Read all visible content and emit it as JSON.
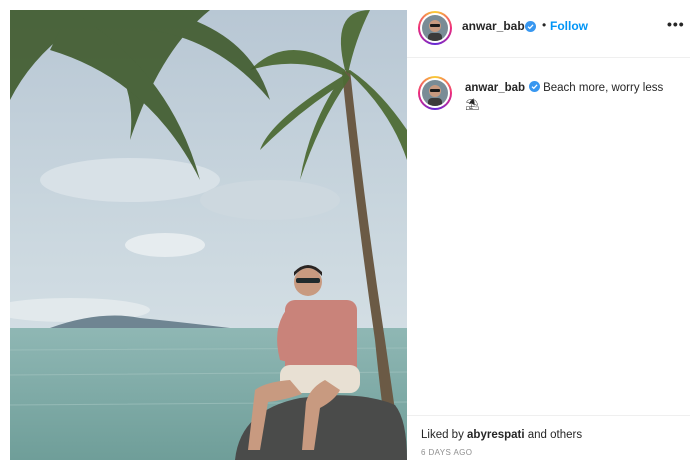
{
  "post": {
    "photo": {
      "description_icon": "beach-photo"
    },
    "header": {
      "username": "anwar_bab",
      "separator": "•",
      "follow_label": "Follow",
      "more_label": "•••"
    },
    "caption": {
      "username": "anwar_bab",
      "text": "Beach more, worry less",
      "emoji": "⛱"
    },
    "likes": {
      "prefix": "Liked by ",
      "user": "abyrespati",
      "suffix": " and others"
    },
    "timestamp": "6 DAYS AGO"
  },
  "colors": {
    "accent": "#0095f6",
    "verified": "#3897f0",
    "text": "#262626",
    "muted": "#8e8e8e"
  }
}
